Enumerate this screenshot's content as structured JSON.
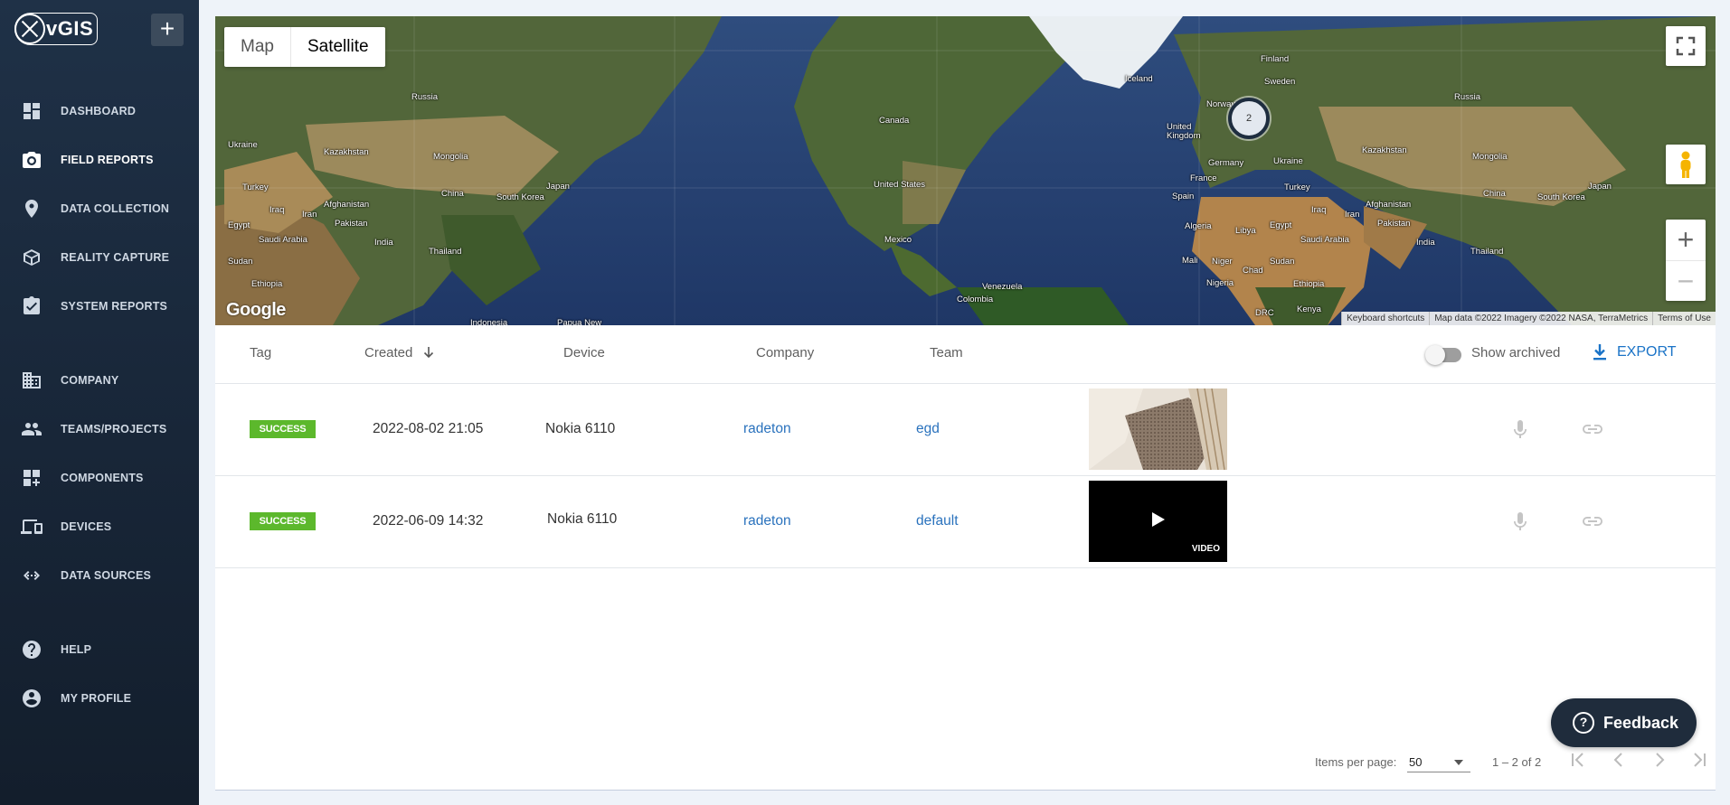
{
  "app": {
    "logo_text": "vGIS",
    "add_label": "+"
  },
  "sidebar": {
    "items": [
      {
        "label": "DASHBOARD",
        "icon": "dashboard-icon"
      },
      {
        "label": "FIELD REPORTS",
        "icon": "camera-icon",
        "active": true
      },
      {
        "label": "DATA COLLECTION",
        "icon": "location-pin-icon"
      },
      {
        "label": "REALITY CAPTURE",
        "icon": "cube-icon"
      },
      {
        "label": "SYSTEM REPORTS",
        "icon": "clipboard-check-icon"
      },
      {
        "label": "COMPANY",
        "icon": "building-icon"
      },
      {
        "label": "TEAMS/PROJECTS",
        "icon": "people-icon"
      },
      {
        "label": "COMPONENTS",
        "icon": "add-widget-icon"
      },
      {
        "label": "DEVICES",
        "icon": "devices-icon"
      },
      {
        "label": "DATA SOURCES",
        "icon": "code-arrows-icon"
      },
      {
        "label": "HELP",
        "icon": "help-icon"
      },
      {
        "label": "MY PROFILE",
        "icon": "account-icon"
      }
    ]
  },
  "map": {
    "type_map": "Map",
    "type_satellite": "Satellite",
    "cluster_count": "2",
    "google": "Google",
    "attribution": [
      "Keyboard shortcuts",
      "Map data ©2022 Imagery ©2022 NASA, TerraMetrics",
      "Terms of Use"
    ],
    "labels": {
      "finland": "Finland",
      "sweden": "Sweden",
      "iceland": "Iceland",
      "norway": "Norway",
      "uk": "United Kingdom",
      "germany": "Germany",
      "ukraine_e": "Ukraine",
      "france": "France",
      "spain": "Spain",
      "russia_w": "Russia",
      "russia_e": "Russia",
      "kazakhstan_w": "Kazakhstan",
      "kazakhstan_e": "Kazakhstan",
      "mongolia_w": "Mongolia",
      "mongolia_e": "Mongolia",
      "china_w": "China",
      "china_e": "China",
      "south_korea_w": "South Korea",
      "south_korea_e": "South Korea",
      "japan_w": "Japan",
      "japan_e": "Japan",
      "ukraine_w": "Ukraine",
      "turkey_w": "Turkey",
      "turkey_e": "Turkey",
      "iraq_w": "Iraq",
      "iraq_e": "Iraq",
      "iran_w": "Iran",
      "iran_e": "Iran",
      "afghanistan_w": "Afghanistan",
      "afghanistan_e": "Afghanistan",
      "pakistan_w": "Pakistan",
      "pakistan_e": "Pakistan",
      "egypt_w": "Egypt",
      "egypt_e": "Egypt",
      "saudi_w": "Saudi Arabia",
      "saudi_e": "Saudi Arabia",
      "india_w": "India",
      "india_e": "India",
      "thailand_w": "Thailand",
      "thailand_e": "Thailand",
      "sudan_w": "Sudan",
      "sudan_e": "Sudan",
      "ethiopia_w": "Ethiopia",
      "ethiopia_e": "Ethiopia",
      "canada": "Canada",
      "us": "United States",
      "mexico": "Mexico",
      "venezuela": "Venezuela",
      "colombia": "Colombia",
      "algeria": "Algeria",
      "libya": "Libya",
      "mali": "Mali",
      "niger": "Niger",
      "chad": "Chad",
      "nigeria": "Nigeria",
      "drc": "DRC",
      "kenya": "Kenya",
      "indonesia": "Indonesia",
      "png": "Papua New"
    }
  },
  "table": {
    "headers": {
      "tag": "Tag",
      "created": "Created",
      "device": "Device",
      "company": "Company",
      "team": "Team"
    },
    "show_archived": "Show archived",
    "export": "EXPORT",
    "rows": [
      {
        "tag": "SUCCESS",
        "created": "2022-08-02 21:05",
        "device": "Nokia 6110",
        "company": "radeton",
        "team": "egd",
        "media": "photo"
      },
      {
        "tag": "SUCCESS",
        "created": "2022-06-09 14:32",
        "device": "Nokia 6110",
        "company": "radeton",
        "team": "default",
        "media": "video",
        "media_label": "VIDEO"
      }
    ]
  },
  "paginator": {
    "items_per_page_label": "Items per page:",
    "items_per_page": "50",
    "range": "1 – 2 of 2"
  },
  "feedback": {
    "label": "Feedback",
    "icon_char": "?"
  },
  "colors": {
    "sidebar": "#1f3147",
    "accent": "#1a73c7",
    "success": "#5cb82c",
    "link": "#2a72bd"
  }
}
